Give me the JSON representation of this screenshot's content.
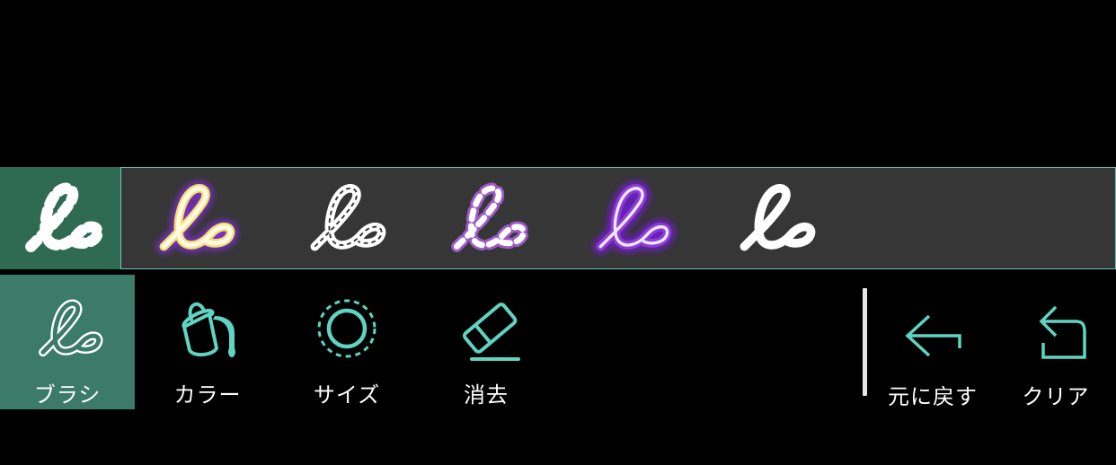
{
  "brushes": [
    {
      "icon": "dotted-brush-icon",
      "selected": true
    },
    {
      "icon": "neon-yellow-brush-icon",
      "selected": false
    },
    {
      "icon": "stitched-brush-icon",
      "selected": false
    },
    {
      "icon": "purple-dotted-brush-icon",
      "selected": false
    },
    {
      "icon": "neon-purple-brush-icon",
      "selected": false
    },
    {
      "icon": "plain-white-brush-icon",
      "selected": false
    }
  ],
  "toolbar": {
    "brush_label": "ブラシ",
    "color_label": "カラー",
    "size_label": "サイズ",
    "eraser_label": "消去",
    "undo_label": "元に戻す",
    "clear_label": "クリア"
  },
  "colors": {
    "accent": "#5fd4c2",
    "active_tool_bg": "#3b7b67",
    "selected_brush_bg": "#2f6b52",
    "strip_bg": "#363636",
    "neon_purple": "#8a3fd1",
    "neon_yellow": "#fff3b0"
  }
}
